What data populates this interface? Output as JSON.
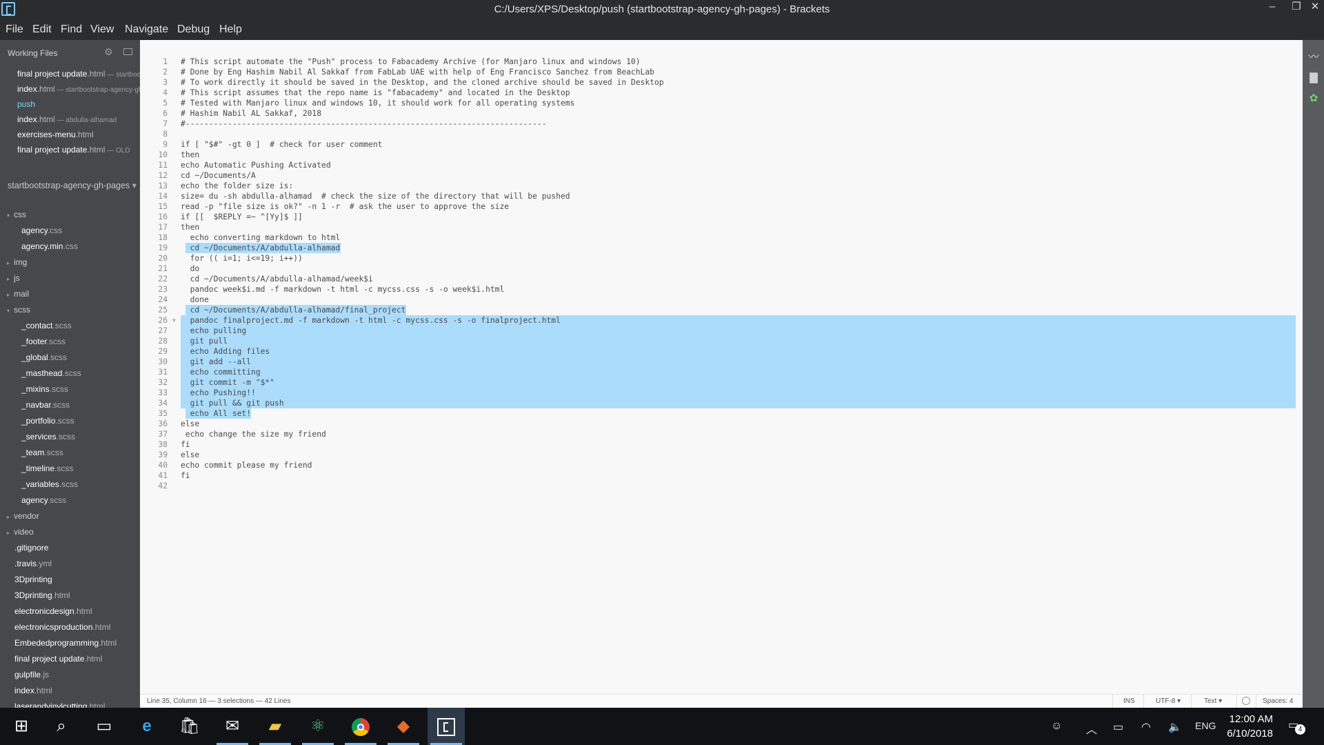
{
  "window": {
    "title": "C:/Users/XPS/Desktop/push (startbootstrap-agency-gh-pages) - Brackets",
    "minimize": "–",
    "restore": "❐",
    "close": "✕"
  },
  "menu": [
    "File",
    "Edit",
    "Find",
    "View",
    "Navigate",
    "Debug",
    "Help"
  ],
  "sidebar": {
    "working_files_title": "Working Files",
    "working_files": [
      {
        "name": "final project update",
        "ext": ".html",
        "sub": " — startbootstrap-agency-gh-pages",
        "active": false
      },
      {
        "name": "index",
        "ext": ".html",
        "sub": " — startbootstrap-agency-gh-pages",
        "active": false
      },
      {
        "name": "push",
        "ext": "",
        "sub": "",
        "active": true
      },
      {
        "name": "index",
        "ext": ".html",
        "sub": " — abdulla-alhamad",
        "active": false
      },
      {
        "name": "exercises-menu",
        "ext": ".html",
        "sub": "",
        "active": false
      },
      {
        "name": "final project update",
        "ext": ".html",
        "sub": " — OLD",
        "active": false
      }
    ],
    "project_title": "startbootstrap-agency-gh-pages",
    "project_dropdown": "▾",
    "tree": [
      {
        "label": "css",
        "ext": "",
        "level": 0,
        "folder": true,
        "open": true
      },
      {
        "label": "agency",
        "ext": ".css",
        "level": 1,
        "folder": false
      },
      {
        "label": "agency.min",
        "ext": ".css",
        "level": 1,
        "folder": false
      },
      {
        "label": "img",
        "ext": "",
        "level": 0,
        "folder": true,
        "open": false
      },
      {
        "label": "js",
        "ext": "",
        "level": 0,
        "folder": true,
        "open": false
      },
      {
        "label": "mail",
        "ext": "",
        "level": 0,
        "folder": true,
        "open": false
      },
      {
        "label": "scss",
        "ext": "",
        "level": 0,
        "folder": true,
        "open": true
      },
      {
        "label": "_contact",
        "ext": ".scss",
        "level": 1,
        "folder": false
      },
      {
        "label": "_footer",
        "ext": ".scss",
        "level": 1,
        "folder": false
      },
      {
        "label": "_global",
        "ext": ".scss",
        "level": 1,
        "folder": false
      },
      {
        "label": "_masthead",
        "ext": ".scss",
        "level": 1,
        "folder": false
      },
      {
        "label": "_mixins",
        "ext": ".scss",
        "level": 1,
        "folder": false
      },
      {
        "label": "_navbar",
        "ext": ".scss",
        "level": 1,
        "folder": false
      },
      {
        "label": "_portfolio",
        "ext": ".scss",
        "level": 1,
        "folder": false
      },
      {
        "label": "_services",
        "ext": ".scss",
        "level": 1,
        "folder": false
      },
      {
        "label": "_team",
        "ext": ".scss",
        "level": 1,
        "folder": false
      },
      {
        "label": "_timeline",
        "ext": ".scss",
        "level": 1,
        "folder": false
      },
      {
        "label": "_variables",
        "ext": ".scss",
        "level": 1,
        "folder": false
      },
      {
        "label": "agency",
        "ext": ".scss",
        "level": 1,
        "folder": false
      },
      {
        "label": "vendor",
        "ext": "",
        "level": 0,
        "folder": true,
        "open": false
      },
      {
        "label": "video",
        "ext": "",
        "level": 0,
        "folder": true,
        "open": false
      },
      {
        "label": ".gitignore",
        "ext": "",
        "level": 0,
        "folder": false
      },
      {
        "label": ".travis",
        "ext": ".yml",
        "level": 0,
        "folder": false
      },
      {
        "label": "3Dprinting",
        "ext": "",
        "level": 0,
        "folder": false
      },
      {
        "label": "3Dprinting",
        "ext": ".html",
        "level": 0,
        "folder": false
      },
      {
        "label": "electronicdesign",
        "ext": ".html",
        "level": 0,
        "folder": false
      },
      {
        "label": "electronicsproduction",
        "ext": ".html",
        "level": 0,
        "folder": false
      },
      {
        "label": "Embededprogramming",
        "ext": ".html",
        "level": 0,
        "folder": false
      },
      {
        "label": "final project update",
        "ext": ".html",
        "level": 0,
        "folder": false
      },
      {
        "label": "gulpfile",
        "ext": ".js",
        "level": 0,
        "folder": false
      },
      {
        "label": "index",
        "ext": ".html",
        "level": 0,
        "folder": false
      },
      {
        "label": "laserandvinylcutting",
        "ext": ".html",
        "level": 0,
        "folder": false
      }
    ]
  },
  "editor": {
    "lines": [
      "# This script automate the \"Push\" process to Fabacademy Archive (for Manjaro linux and windows 10)",
      "# Done by Eng Hashim Nabil Al Sakkaf from FabLab UAE with help of Eng Francisco Sanchez from BeachLab",
      "# To work directly it should be saved in the Desktop, and the cloned archive should be saved in Desktop",
      "# This script assumes that the repo name is \"fabacademy\" and located in the Desktop",
      "# Tested with Manjaro linux and windows 10, it should work for all operating systems",
      "# Hashim Nabil AL Sakkaf, 2018",
      "#-----------------------------------------------------------------------------",
      "",
      "if [ \"$#\" -gt 0 ]  # check for user comment",
      "then",
      "echo Automatic Pushing Activated",
      "cd ~/Documents/A",
      "echo the folder size is:",
      "size= du -sh abdulla-alhamad  # check the size of the directory that will be pushed",
      "read -p \"file size is ok?\" -n 1 -r  # ask the user to approve the size",
      "if [[  $REPLY =~ ^[Yy]$ ]]",
      "then",
      "  echo converting markdown to html",
      "  cd ~/Documents/A/abdulla-alhamad",
      "  for (( i=1; i<=19; i++))",
      "  do",
      "  cd ~/Documents/A/abdulla-alhamad/week$i",
      "  pandoc week$i.md -f markdown -t html -c mycss.css -s -o week$i.html",
      "  done",
      "  cd ~/Documents/A/abdulla-alhamad/final_project",
      "  pandoc finalproject.md -f markdown -t html -c mycss.css -s -o finalproject.html",
      "  echo pulling",
      "  git pull",
      "  echo Adding files",
      "  git add --all",
      "  echo committing",
      "  git commit -m \"$*\"",
      "  echo Pushing!!",
      "  git pull && git push",
      "  echo All set!",
      "else",
      " echo change the size my friend",
      "fi",
      "else",
      "echo commit please my friend",
      "fi",
      ""
    ],
    "selections": {
      "partial": [
        19,
        25,
        35
      ],
      "full": [
        26,
        27,
        28,
        29,
        30,
        31,
        32,
        33,
        34
      ],
      "fold_line": 26
    }
  },
  "statusbar": {
    "cursor": "Line 35, Column 16 — 3 selections — 42 Lines",
    "mode": "INS",
    "encoding": "UTF-8 ▾",
    "language": "Text ▾",
    "spaces": "Spaces: 4"
  },
  "taskbar": {
    "language": "ENG",
    "time": "12:00 AM",
    "date": "6/10/2018",
    "notifications": "4",
    "icons": [
      "windows-start-icon",
      "search-icon",
      "task-view-icon",
      "edge-browser-icon",
      "store-icon",
      "mail-icon",
      "file-explorer-icon",
      "atom-app-icon",
      "chrome-icon",
      "git-app-icon",
      "brackets-app-icon"
    ]
  },
  "colors": {
    "accent": "#7ed4ff",
    "selection": "#abdcfb",
    "sidebar_bg": "#47484b",
    "editor_bg": "#f8f8f8"
  }
}
